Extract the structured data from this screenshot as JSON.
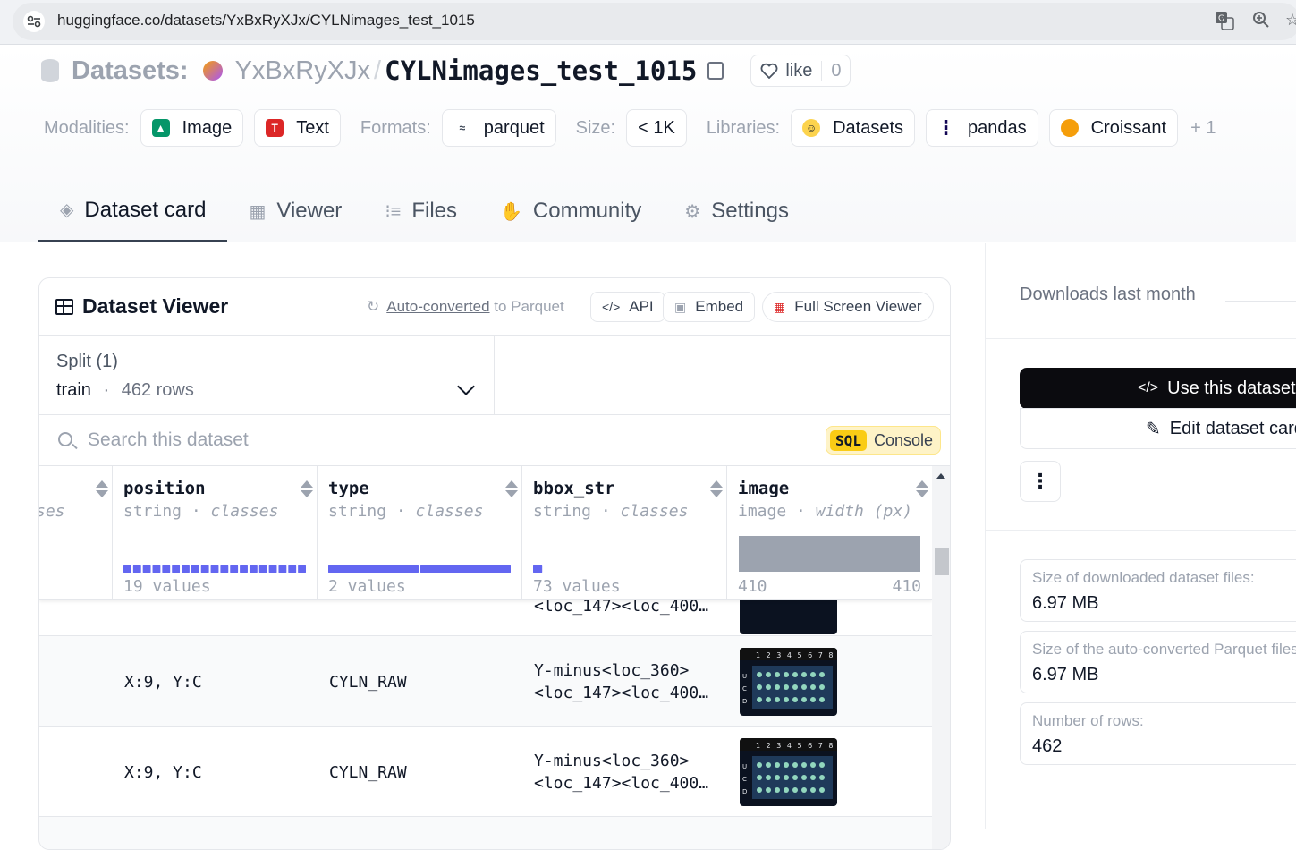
{
  "browser": {
    "url": "huggingface.co/datasets/YxBxRyXJx/CYLNimages_test_1015"
  },
  "dataset": {
    "label": "Datasets:",
    "owner": "YxBxRyXJx",
    "separator": "/",
    "name": "CYLNimages_test_1015",
    "like_label": "like",
    "like_count": "0"
  },
  "tags": {
    "modalities_label": "Modalities:",
    "modalities": [
      "Image",
      "Text"
    ],
    "formats_label": "Formats:",
    "format": "parquet",
    "size_label": "Size:",
    "size": "< 1K",
    "libraries_label": "Libraries:",
    "libraries": [
      "Datasets",
      "pandas",
      "Croissant"
    ],
    "more": "+ 1"
  },
  "tabs": [
    {
      "label": "Dataset card",
      "active": true
    },
    {
      "label": "Viewer"
    },
    {
      "label": "Files"
    },
    {
      "label": "Community"
    },
    {
      "label": "Settings"
    }
  ],
  "viewer": {
    "title": "Dataset Viewer",
    "auto_link": "Auto-converted",
    "auto_rest": " to Parquet",
    "api": "API",
    "embed": "Embed",
    "fullscreen": "Full Screen Viewer",
    "split_label": "Split (1)",
    "split_name": "train",
    "split_dot": "·",
    "split_rows": "462 rows",
    "search_placeholder": "Search this dataset",
    "sql_tag": "SQL",
    "sql_label": "Console"
  },
  "columns": [
    {
      "name": "",
      "type": "ses",
      "stat": ""
    },
    {
      "name": "position",
      "type": "string",
      "kind": "classes",
      "stat": "19 values",
      "fill": 1.0
    },
    {
      "name": "type",
      "type": "string",
      "kind": "classes",
      "stat": "2 values",
      "fill": 1.0
    },
    {
      "name": "bbox_str",
      "type": "string",
      "kind": "classes",
      "stat": "73 values",
      "fill": 0.05
    },
    {
      "name": "image",
      "type": "image",
      "kind": "width (px)",
      "stat_min": "410",
      "stat_max": "410"
    }
  ],
  "rows": [
    {
      "position": "",
      "type": "",
      "bbox_line1": "<loc_147><loc_400…",
      "bbox_line2": ""
    },
    {
      "position": "X:9, Y:C",
      "type": "CYLN_RAW",
      "bbox_line1": "Y-minus<loc_360>",
      "bbox_line2": "<loc_147><loc_400…"
    },
    {
      "position": "X:9, Y:C",
      "type": "CYLN_RAW",
      "bbox_line1": "Y-minus<loc_360>",
      "bbox_line2": "<loc_147><loc_400…"
    }
  ],
  "thumb_labels": {
    "top": "1 2 3 4 5 6 7 8 9",
    "side": [
      "U",
      "C",
      "D"
    ]
  },
  "sidebar": {
    "downloads_label": "Downloads last month",
    "use_dataset": "Use this dataset",
    "edit_card": "Edit dataset card",
    "more": "⋮",
    "stats": [
      {
        "label": "Size of downloaded dataset files:",
        "value": "6.97 MB"
      },
      {
        "label": "Size of the auto-converted Parquet files:",
        "value": "6.97 MB"
      },
      {
        "label": "Number of rows:",
        "value": "462"
      }
    ]
  },
  "colors": {
    "accent_bar": "#6366f1",
    "image_bar": "#9ca3af",
    "sql_yellow": "#facc15"
  }
}
